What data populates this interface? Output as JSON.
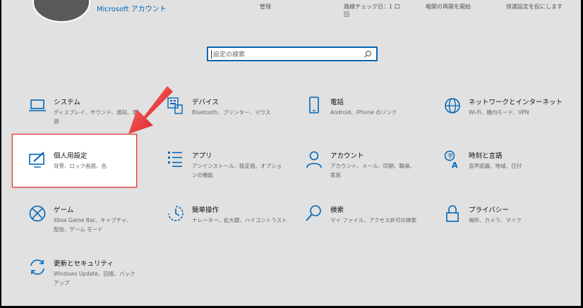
{
  "header": {
    "account_link": "Microsoft アカウント",
    "items": [
      {
        "label": "管理"
      },
      {
        "label": "路線チェック日：1 口",
        "sub": "回"
      },
      {
        "label": "報開の再開を開始"
      },
      {
        "label": "排選設定を役にします"
      }
    ]
  },
  "search": {
    "placeholder": "設定の検索"
  },
  "tiles": [
    {
      "title": "システム",
      "desc": "ディスプレイ、サウンド、通知、電源",
      "icon": "laptop-icon"
    },
    {
      "title": "デバイス",
      "desc": "Bluetooth、プリンター、マウス",
      "icon": "keyboard-icon"
    },
    {
      "title": "電話",
      "desc": "Android、iPhone のリンク",
      "icon": "phone-icon"
    },
    {
      "title": "ネットワークとインターネット",
      "desc": "Wi-Fi、機内モード、VPN",
      "icon": "globe-icon"
    },
    {
      "title": "個人用設定",
      "desc": "背景、ロック画面、色",
      "icon": "paintbrush-icon"
    },
    {
      "title": "アプリ",
      "desc": "アンインストール、既定値、オプションの機能",
      "icon": "apps-list-icon"
    },
    {
      "title": "アカウント",
      "desc": "アカウント、メール、同期、職場、家族",
      "icon": "person-icon"
    },
    {
      "title": "時刻と言語",
      "desc": "音声認識、地域、日付",
      "icon": "time-language-icon"
    },
    {
      "title": "ゲーム",
      "desc": "Xbox Game Bar、キャプチャ、配信、ゲーム モード",
      "icon": "xbox-icon"
    },
    {
      "title": "簡単操作",
      "desc": "ナレーター、拡大鏡、ハイコントラスト",
      "icon": "ease-of-access-icon"
    },
    {
      "title": "検索",
      "desc": "マイ ファイル、アクセス許可の検索",
      "icon": "magnifier-icon"
    },
    {
      "title": "プライバシー",
      "desc": "場所、カメラ、マイク",
      "icon": "lock-icon"
    },
    {
      "title": "更新とセキュリティ",
      "desc": "Windows Update、回復、バックアップ",
      "icon": "sync-icon"
    }
  ],
  "colors": {
    "accent": "#0067b8",
    "highlight_border": "#e52a2a",
    "background": "#e1e1e1"
  }
}
